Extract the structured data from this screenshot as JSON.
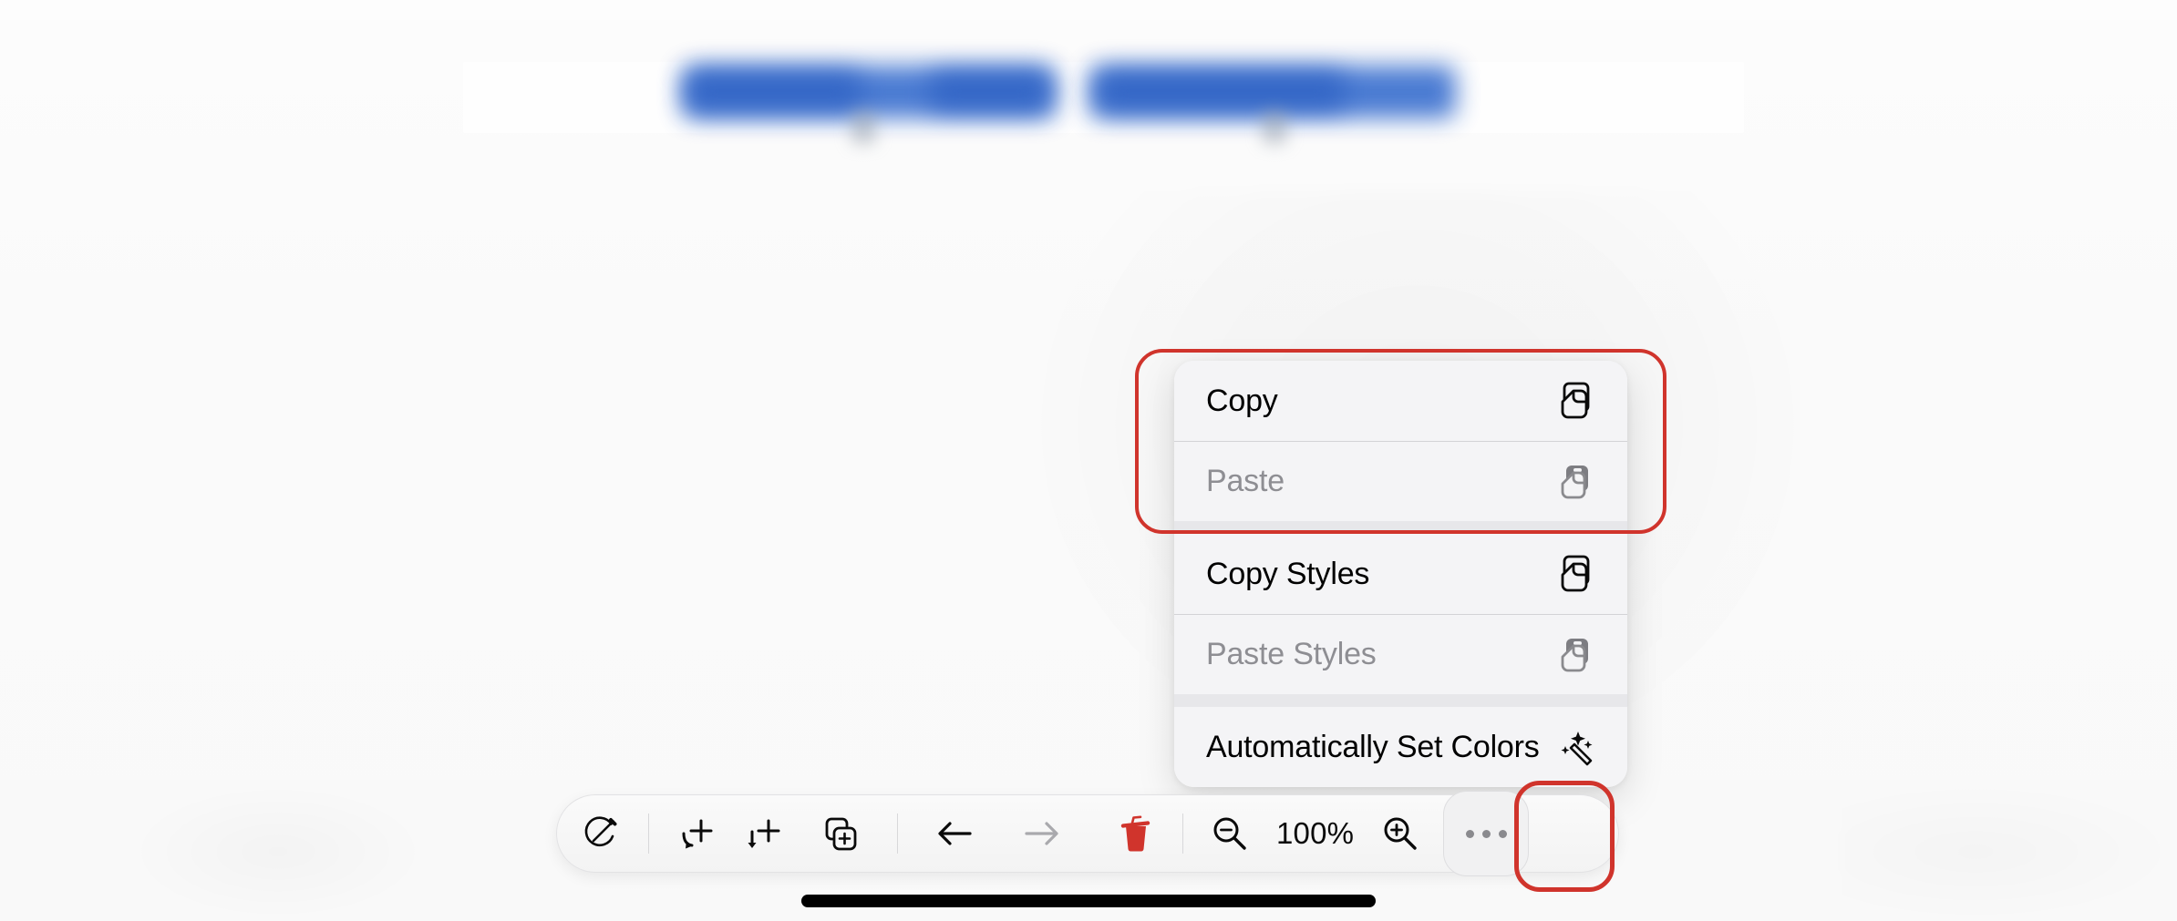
{
  "app": {
    "zoom_level": "100%",
    "accent_red": "#d0342c",
    "menu_bg": "#f4f4f6",
    "disabled_text": "#8e8e93",
    "redaction_color": "#3f73d0"
  },
  "context_menu": {
    "groups": [
      {
        "highlighted": true,
        "items": [
          {
            "label": "Copy",
            "icon": "copy-icon",
            "enabled": true
          },
          {
            "label": "Paste",
            "icon": "paste-icon",
            "enabled": false
          }
        ]
      },
      {
        "highlighted": false,
        "items": [
          {
            "label": "Copy Styles",
            "icon": "copy-icon",
            "enabled": true
          },
          {
            "label": "Paste Styles",
            "icon": "paste-icon",
            "enabled": false
          }
        ]
      },
      {
        "highlighted": false,
        "items": [
          {
            "label": "Automatically Set Colors",
            "icon": "magic-wand-icon",
            "enabled": true
          }
        ]
      }
    ]
  },
  "toolbar": {
    "items": [
      {
        "name": "style-tool-button",
        "icon": "circle-pencil-icon",
        "enabled": true
      },
      {
        "name": "add-row-button",
        "icon": "add-row-arrow-icon",
        "enabled": true
      },
      {
        "name": "add-column-button",
        "icon": "add-column-arrow-icon",
        "enabled": true
      },
      {
        "name": "duplicate-button",
        "icon": "duplicate-plus-icon",
        "enabled": true
      },
      {
        "name": "undo-button",
        "icon": "arrow-left-icon",
        "enabled": true
      },
      {
        "name": "redo-button",
        "icon": "arrow-right-icon",
        "enabled": false
      },
      {
        "name": "delete-button",
        "icon": "trash-icon",
        "enabled": true
      },
      {
        "name": "zoom-out-button",
        "icon": "magnifier-minus-icon",
        "enabled": true
      },
      {
        "name": "zoom-level-label",
        "icon": "",
        "enabled": false
      },
      {
        "name": "zoom-in-button",
        "icon": "magnifier-plus-icon",
        "enabled": true
      },
      {
        "name": "more-options-button",
        "icon": "ellipsis-icon",
        "enabled": true
      }
    ],
    "zoom_label": "100%"
  },
  "annotations": [
    {
      "name": "highlight-copy-paste-group",
      "color": "#d0342c"
    },
    {
      "name": "highlight-more-options-button",
      "color": "#d0342c"
    }
  ],
  "redacted_blocks": [
    {
      "name": "redacted-label-left"
    },
    {
      "name": "redacted-label-right"
    }
  ]
}
